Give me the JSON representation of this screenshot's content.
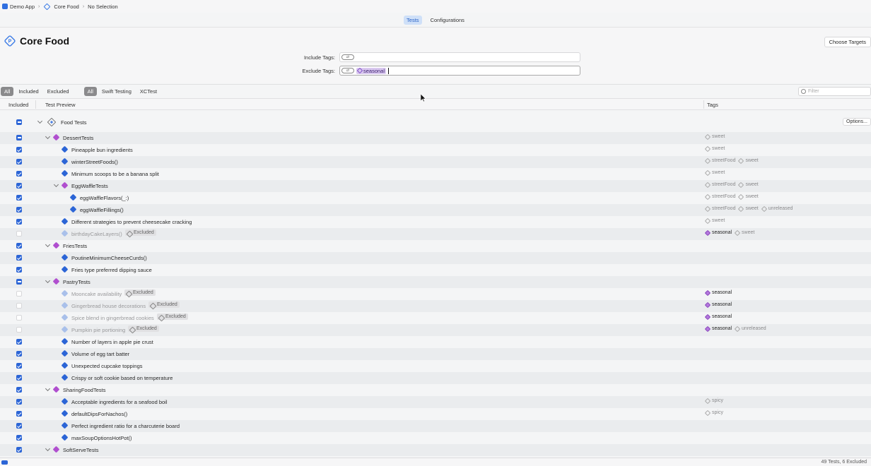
{
  "breadcrumb": {
    "app": "Demo App",
    "plan": "Core Food",
    "selection": "No Selection"
  },
  "tabs": [
    {
      "label": "Tests",
      "active": true
    },
    {
      "label": "Configurations",
      "active": false
    }
  ],
  "header": {
    "title": "Core Food",
    "choose_targets": "Choose Targets",
    "include_label": "Include Tags:",
    "exclude_label": "Exclude Tags:",
    "exclude_token": "seasonal"
  },
  "filters": {
    "status": [
      "All",
      "Included",
      "Excluded"
    ],
    "kind": [
      "All",
      "Swift Testing",
      "XCTest"
    ],
    "search_placeholder": "Filter"
  },
  "columns": {
    "included": "Included",
    "test": "Test Preview",
    "tags": "Tags"
  },
  "root": {
    "label": "Food Tests",
    "options": "Options..."
  },
  "excluded_label": "Excluded",
  "rows": [
    {
      "name": "DessertTests",
      "type": "suite",
      "level": 1,
      "check": "mixed",
      "tags": [
        {
          "t": "sweet"
        }
      ]
    },
    {
      "name": "Pineapple bun ingredients",
      "type": "test",
      "level": 2,
      "check": "checked",
      "tags": [
        {
          "t": "sweet"
        }
      ]
    },
    {
      "name": "winterStreetFoods()",
      "type": "test",
      "level": 2,
      "check": "checked",
      "tags": [
        {
          "t": "streetFood"
        },
        {
          "t": "sweet"
        }
      ]
    },
    {
      "name": "Minimum scoops to be a banana split",
      "type": "test",
      "level": 2,
      "check": "checked",
      "tags": [
        {
          "t": "sweet"
        }
      ]
    },
    {
      "name": "EggWaffleTests",
      "type": "suite",
      "level": 2,
      "check": "checked",
      "tags": [
        {
          "t": "streetFood"
        },
        {
          "t": "sweet"
        }
      ]
    },
    {
      "name": "eggWaffleFlavors(_:)",
      "type": "test",
      "level": 3,
      "check": "checked",
      "tags": [
        {
          "t": "streetFood"
        },
        {
          "t": "sweet"
        }
      ]
    },
    {
      "name": "eggWaffleFillings()",
      "type": "test",
      "level": 3,
      "check": "checked",
      "tags": [
        {
          "t": "streetFood"
        },
        {
          "t": "sweet"
        },
        {
          "t": "unreleased"
        }
      ]
    },
    {
      "name": "Different strategies to prevent cheesecake cracking",
      "type": "test",
      "level": 2,
      "check": "checked",
      "tags": [
        {
          "t": "sweet"
        }
      ]
    },
    {
      "name": "birthdayCakeLayers()",
      "type": "test",
      "level": 2,
      "check": "off",
      "excluded": true,
      "tags": [
        {
          "t": "seasonal",
          "hl": true
        },
        {
          "t": "sweet"
        }
      ]
    },
    {
      "name": "FriesTests",
      "type": "suite",
      "level": 1,
      "check": "checked",
      "tags": []
    },
    {
      "name": "PoutineMinimumCheeseCurds()",
      "type": "test",
      "level": 2,
      "check": "checked",
      "tags": []
    },
    {
      "name": "Fries type preferred dipping sauce",
      "type": "test",
      "level": 2,
      "check": "checked",
      "tags": []
    },
    {
      "name": "PastryTests",
      "type": "suite",
      "level": 1,
      "check": "mixed",
      "tags": []
    },
    {
      "name": "Mooncake availability",
      "type": "test",
      "level": 2,
      "check": "off",
      "excluded": true,
      "tags": [
        {
          "t": "seasonal",
          "hl": true
        }
      ]
    },
    {
      "name": "Gingerbread house decorations",
      "type": "test",
      "level": 2,
      "check": "off",
      "excluded": true,
      "tags": [
        {
          "t": "seasonal",
          "hl": true
        }
      ]
    },
    {
      "name": "Spice blend in gingerbread cookies",
      "type": "test",
      "level": 2,
      "check": "off",
      "excluded": true,
      "tags": [
        {
          "t": "seasonal",
          "hl": true
        }
      ]
    },
    {
      "name": "Pumpkin pie portioning",
      "type": "test",
      "level": 2,
      "check": "off",
      "excluded": true,
      "tags": [
        {
          "t": "seasonal",
          "hl": true
        },
        {
          "t": "unreleased"
        }
      ]
    },
    {
      "name": "Number of layers in apple pie crust",
      "type": "test",
      "level": 2,
      "check": "checked",
      "tags": []
    },
    {
      "name": "Volume of egg tart batter",
      "type": "test",
      "level": 2,
      "check": "checked",
      "tags": []
    },
    {
      "name": "Unexpected cupcake toppings",
      "type": "test",
      "level": 2,
      "check": "checked",
      "tags": []
    },
    {
      "name": "Crispy or soft cookie based on temperature",
      "type": "test",
      "level": 2,
      "check": "checked",
      "tags": []
    },
    {
      "name": "SharingFoodTests",
      "type": "suite",
      "level": 1,
      "check": "checked",
      "tags": []
    },
    {
      "name": "Acceptable ingredients for a seafood boil",
      "type": "test",
      "level": 2,
      "check": "checked",
      "tags": [
        {
          "t": "spicy"
        }
      ]
    },
    {
      "name": "defaultDipsForNachos()",
      "type": "test",
      "level": 2,
      "check": "checked",
      "tags": [
        {
          "t": "spicy"
        }
      ]
    },
    {
      "name": "Perfect ingredient ratio for a charcuterie board",
      "type": "test",
      "level": 2,
      "check": "checked",
      "tags": []
    },
    {
      "name": "maxSoupOptionsHotPot()",
      "type": "test",
      "level": 2,
      "check": "checked",
      "tags": []
    },
    {
      "name": "SoftServeTests",
      "type": "suite",
      "level": 1,
      "check": "checked",
      "tags": []
    }
  ],
  "status": {
    "summary": "49 Tests, 6 Excluded"
  },
  "colors": {
    "accent": "#2c65d6",
    "suite": "#b04fcf",
    "tag_highlight": "#b479dd"
  }
}
